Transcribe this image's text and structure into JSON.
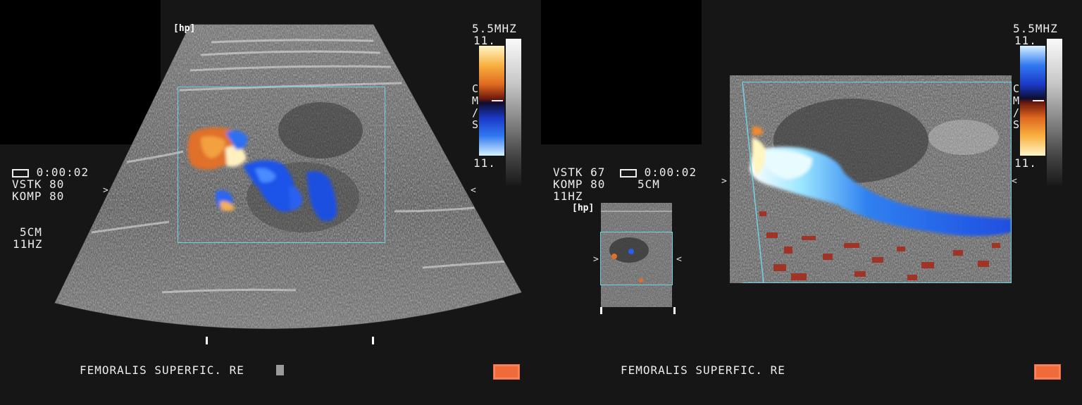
{
  "left": {
    "freq": "5.5MHZ",
    "scale_top": "11.",
    "scale_bottom": "11.",
    "cms": [
      "C",
      "M",
      "/",
      "S"
    ],
    "probe_badge": "hp",
    "timer": "0:00:02",
    "vstk": "VSTK 80",
    "komp": "KOMP 80",
    "depth": "5CM",
    "framerate": "11HZ",
    "caption": "FEMORALIS SUPERFIC. RE",
    "colors": {
      "roi": "#6fd2e6",
      "record": "#f06a3a"
    }
  },
  "right": {
    "freq": "5.5MHZ",
    "scale_top": "11.",
    "scale_bottom": "11.",
    "cms": [
      "C",
      "M",
      "/",
      "S"
    ],
    "probe_badge": "hp",
    "timer": "0:00:02",
    "vstk": "VSTK 67",
    "komp": "KOMP 80",
    "depth": "5CM",
    "framerate": "11HZ",
    "caption": "FEMORALIS SUPERFIC. RE",
    "colors": {
      "roi": "#6fd2e6",
      "record": "#f06a3a"
    }
  }
}
